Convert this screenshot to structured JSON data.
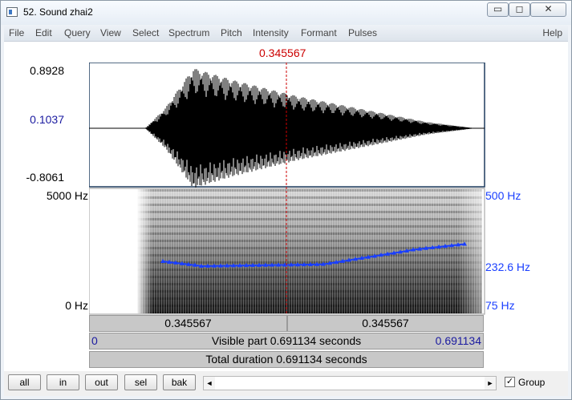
{
  "window": {
    "title": "52. Sound zhai2",
    "minimize_glyph": "▭",
    "maximize_glyph": "◻",
    "close_glyph": "✕"
  },
  "menu": {
    "items": [
      "File",
      "Edit",
      "Query",
      "View",
      "Select",
      "Spectrum",
      "Pitch",
      "Intensity",
      "Formant",
      "Pulses"
    ],
    "help": "Help"
  },
  "cursor": {
    "time": "0.345567",
    "color": "#cc0000"
  },
  "waveform": {
    "max": "0.8928",
    "mid": "0.1037",
    "min": "-0.8061"
  },
  "spectrogram": {
    "top": "5000 Hz",
    "bottom": "0 Hz"
  },
  "pitch": {
    "top": "500 Hz",
    "mid": "232.6 Hz",
    "bottom": "75 Hz",
    "color": "#1a3fff"
  },
  "time_bars": {
    "left_segment": "0.345567",
    "right_segment": "0.345567",
    "visible_start": "0",
    "visible_text": "Visible part 0.691134 seconds",
    "visible_end": "0.691134",
    "total_text": "Total duration 0.691134 seconds"
  },
  "buttons": {
    "all": "all",
    "in": "in",
    "out": "out",
    "sel": "sel",
    "bak": "bak"
  },
  "scrollbar": {
    "left_arrow": "◄",
    "right_arrow": "►"
  },
  "group": {
    "label": "Group",
    "checked": true,
    "check_glyph": "✓"
  }
}
